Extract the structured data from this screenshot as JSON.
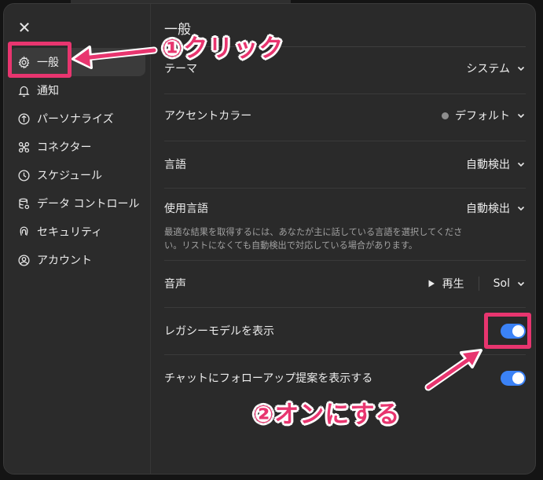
{
  "sidebar": {
    "close_glyph": "✕",
    "items": [
      {
        "label": "一般",
        "icon": "gear-icon"
      },
      {
        "label": "通知",
        "icon": "bell-icon"
      },
      {
        "label": "パーソナライズ",
        "icon": "personalize-icon"
      },
      {
        "label": "コネクター",
        "icon": "connector-icon"
      },
      {
        "label": "スケジュール",
        "icon": "clock-icon"
      },
      {
        "label": "データ コントロール",
        "icon": "database-icon"
      },
      {
        "label": "セキュリティ",
        "icon": "security-icon"
      },
      {
        "label": "アカウント",
        "icon": "account-icon"
      }
    ]
  },
  "content": {
    "title": "一般",
    "theme": {
      "label": "テーマ",
      "value": "システム"
    },
    "accent": {
      "label": "アクセントカラー",
      "value": "デフォルト",
      "dot_color": "#8e8e8e"
    },
    "language": {
      "label": "言語",
      "value": "自動検出"
    },
    "spoken_language": {
      "label": "使用言語",
      "value": "自動検出",
      "description": "最適な結果を取得するには、あなたが主に話している言語を選択してください。リストになくても自動検出で対応している場合があります。"
    },
    "voice": {
      "label": "音声",
      "play_label": "再生",
      "value": "Sol"
    },
    "legacy_models": {
      "label": "レガシーモデルを表示",
      "enabled": true
    },
    "followup": {
      "label": "チャットにフォローアップ提案を表示する",
      "enabled": true
    }
  },
  "annotations": {
    "step1": "①クリック",
    "step2": "②オンにする",
    "color": "#e8356f"
  },
  "colors": {
    "toggle_on": "#3b82f6",
    "modal_bg": "#2a2a2a"
  }
}
